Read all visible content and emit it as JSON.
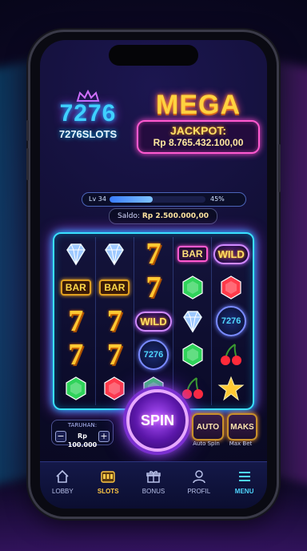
{
  "header": {
    "logo_number": "7276",
    "logo_text": "7276SLOTS",
    "mega_title": "MEGA",
    "jackpot_label": "JACKPOT:",
    "jackpot_value": "Rp 8.765.432.100,00"
  },
  "status": {
    "level_label": "Lv 34",
    "level_progress": 0.45,
    "level_percent": "45%",
    "balance_label": "Saldo:",
    "balance_value": "Rp 2.500.000,00"
  },
  "reels": [
    [
      {
        "type": "diamond",
        "color": "#9ec9ff"
      },
      {
        "type": "bar",
        "label": "BAR"
      },
      {
        "type": "seven",
        "label": "7"
      },
      {
        "type": "seven",
        "label": "7"
      },
      {
        "type": "gem",
        "color": "#2fd35a"
      }
    ],
    [
      {
        "type": "diamond",
        "color": "#9ec9ff"
      },
      {
        "type": "bar",
        "label": "BAR"
      },
      {
        "type": "seven",
        "label": "7"
      },
      {
        "type": "seven",
        "label": "7"
      },
      {
        "type": "gem",
        "color": "#ff3a4a"
      }
    ],
    [
      {
        "type": "seven",
        "label": "7"
      },
      {
        "type": "seven",
        "label": "7"
      },
      {
        "type": "wild",
        "label": "WILD"
      },
      {
        "type": "logo",
        "label": "7276"
      },
      {
        "type": "gem",
        "color": "#2fd35a"
      }
    ],
    [
      {
        "type": "bar",
        "label": "BAR"
      },
      {
        "type": "gem",
        "color": "#2fd35a"
      },
      {
        "type": "diamond",
        "color": "#9ec9ff"
      },
      {
        "type": "gem",
        "color": "#2fd35a"
      },
      {
        "type": "cherry",
        "color": "#ff2a3a"
      }
    ],
    [
      {
        "type": "wild",
        "label": "WILD"
      },
      {
        "type": "gem",
        "color": "#ff3a4a"
      },
      {
        "type": "logo",
        "label": "7276"
      },
      {
        "type": "cherry",
        "color": "#ff2a3a"
      },
      {
        "type": "star",
        "color": "#ffc933"
      }
    ]
  ],
  "controls": {
    "bet_label": "TARUHAN:",
    "bet_value": "Rp 100.000",
    "minus_label": "−",
    "plus_label": "+",
    "spin_label": "SPIN",
    "auto_label": "AUTO",
    "auto_caption": "Auto Spin",
    "max_label": "MAKS",
    "max_caption": "Max Bet"
  },
  "nav": [
    {
      "label": "LOBBY",
      "icon": "home-icon"
    },
    {
      "label": "SLOTS",
      "icon": "slot-machine-icon",
      "active": true
    },
    {
      "label": "BONUS",
      "icon": "gift-icon"
    },
    {
      "label": "PROFIL",
      "icon": "user-icon"
    },
    {
      "label": "MENU",
      "icon": "menu-icon"
    }
  ]
}
